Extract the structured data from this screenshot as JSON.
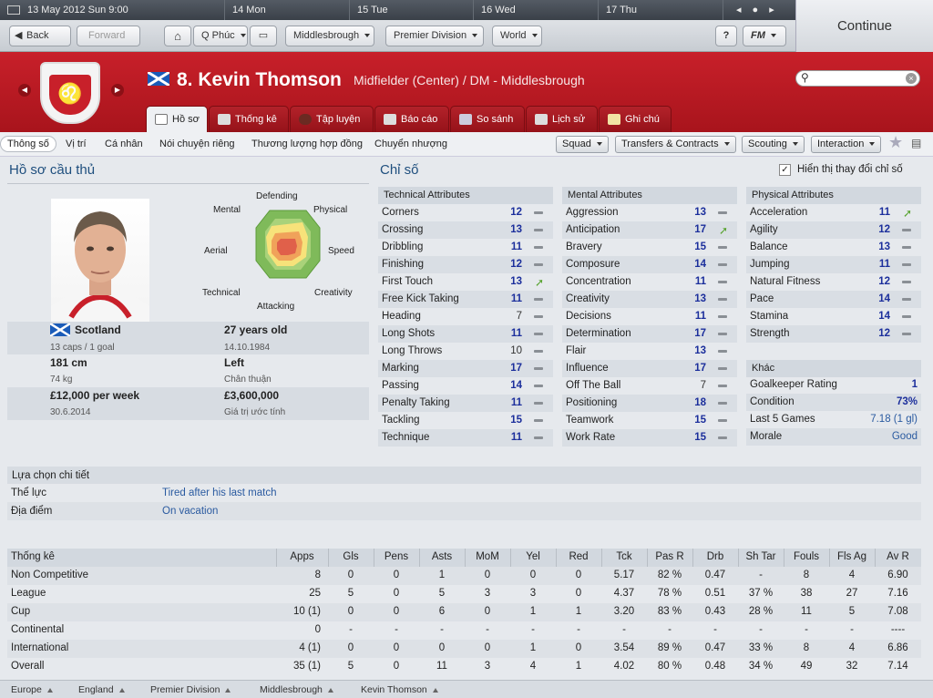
{
  "calendar": {
    "current": "13 May 2012 Sun 9:00",
    "days": [
      "14 Mon",
      "15 Tue",
      "16 Wed",
      "17 Thu"
    ]
  },
  "toolbar": {
    "back": "Back",
    "forward": "Forward",
    "manager": "Q Phúc",
    "club": "Middlesbrough",
    "league": "Premier Division",
    "world": "World",
    "help": "?",
    "fm": "FM",
    "continue": "Continue"
  },
  "player": {
    "number_name": "8. Kevin Thomson",
    "position": "Midfielder (Center) / DM - Middlesbrough"
  },
  "tabs": [
    "Hồ sơ",
    "Thống kê",
    "Tập luyện",
    "Báo cáo",
    "So sánh",
    "Lịch sử",
    "Ghi chú"
  ],
  "subnav": [
    "Thông số",
    "Vị trí",
    "Cá nhân",
    "Nói chuyện riêng",
    "Thương lượng hợp đồng",
    "Chuyển nhượng"
  ],
  "menus": [
    "Squad",
    "Transfers & Contracts",
    "Scouting",
    "Interaction"
  ],
  "profile": {
    "title": "Hồ sơ cầu thủ",
    "radar": [
      "Defending",
      "Physical",
      "Speed",
      "Creativity",
      "Attacking",
      "Technical",
      "Aerial",
      "Mental"
    ],
    "nation": "Scotland",
    "caps": "13 caps / 1 goal",
    "age": "27 years old",
    "dob": "14.10.1984",
    "height": "181 cm",
    "weight": "74 kg",
    "foot": "Left",
    "foot_label": "Chân thuận",
    "wage": "£12,000 per week",
    "contract": "30.6.2014",
    "value": "£3,600,000",
    "value_label": "Giá trị ước tính"
  },
  "attributes": {
    "title": "Chỉ số",
    "show_changes": "Hiển thị thay đổi chỉ số",
    "technical_title": "Technical Attributes",
    "technical": [
      {
        "n": "Corners",
        "v": "12",
        "t": "dash"
      },
      {
        "n": "Crossing",
        "v": "13",
        "t": "dash"
      },
      {
        "n": "Dribbling",
        "v": "11",
        "t": "dash"
      },
      {
        "n": "Finishing",
        "v": "12",
        "t": "dash"
      },
      {
        "n": "First Touch",
        "v": "13",
        "t": "up"
      },
      {
        "n": "Free Kick Taking",
        "v": "11",
        "t": "dash"
      },
      {
        "n": "Heading",
        "v": "7",
        "t": "dash"
      },
      {
        "n": "Long Shots",
        "v": "11",
        "t": "dash"
      },
      {
        "n": "Long Throws",
        "v": "10",
        "t": "dash"
      },
      {
        "n": "Marking",
        "v": "17",
        "t": "dash"
      },
      {
        "n": "Passing",
        "v": "14",
        "t": "dash"
      },
      {
        "n": "Penalty Taking",
        "v": "11",
        "t": "dash"
      },
      {
        "n": "Tackling",
        "v": "15",
        "t": "dash"
      },
      {
        "n": "Technique",
        "v": "11",
        "t": "dash"
      }
    ],
    "mental_title": "Mental Attributes",
    "mental": [
      {
        "n": "Aggression",
        "v": "13",
        "t": "dash"
      },
      {
        "n": "Anticipation",
        "v": "17",
        "t": "up"
      },
      {
        "n": "Bravery",
        "v": "15",
        "t": "dash"
      },
      {
        "n": "Composure",
        "v": "14",
        "t": "dash"
      },
      {
        "n": "Concentration",
        "v": "11",
        "t": "dash"
      },
      {
        "n": "Creativity",
        "v": "13",
        "t": "dash"
      },
      {
        "n": "Decisions",
        "v": "11",
        "t": "dash"
      },
      {
        "n": "Determination",
        "v": "17",
        "t": "dash"
      },
      {
        "n": "Flair",
        "v": "13",
        "t": "dash"
      },
      {
        "n": "Influence",
        "v": "17",
        "t": "dash"
      },
      {
        "n": "Off The Ball",
        "v": "7",
        "t": "dash"
      },
      {
        "n": "Positioning",
        "v": "18",
        "t": "dash"
      },
      {
        "n": "Teamwork",
        "v": "15",
        "t": "dash"
      },
      {
        "n": "Work Rate",
        "v": "15",
        "t": "dash"
      }
    ],
    "physical_title": "Physical Attributes",
    "physical": [
      {
        "n": "Acceleration",
        "v": "11",
        "t": "up"
      },
      {
        "n": "Agility",
        "v": "12",
        "t": "dash"
      },
      {
        "n": "Balance",
        "v": "13",
        "t": "dash"
      },
      {
        "n": "Jumping",
        "v": "11",
        "t": "dash"
      },
      {
        "n": "Natural Fitness",
        "v": "12",
        "t": "dash"
      },
      {
        "n": "Pace",
        "v": "14",
        "t": "dash"
      },
      {
        "n": "Stamina",
        "v": "14",
        "t": "dash"
      },
      {
        "n": "Strength",
        "v": "12",
        "t": "dash"
      }
    ],
    "other_title": "Khác",
    "other": [
      {
        "n": "Goalkeeper Rating",
        "v": "1"
      },
      {
        "n": "Condition",
        "v": "73%"
      },
      {
        "n": "Last 5 Games",
        "v": "7.18 (1 gl)"
      },
      {
        "n": "Morale",
        "v": "Good"
      }
    ]
  },
  "details": {
    "title": "Lựa chọn chi tiết",
    "rows": [
      {
        "l": "Thể lực",
        "v": "Tired after his last match"
      },
      {
        "l": "Địa điểm",
        "v": "On vacation"
      }
    ]
  },
  "stats": {
    "headers": [
      "Thống kê",
      "Apps",
      "Gls",
      "Pens",
      "Asts",
      "MoM",
      "Yel",
      "Red",
      "Tck",
      "Pas R",
      "Drb",
      "Sh Tar",
      "Fouls",
      "Fls Ag",
      "Av R"
    ],
    "rows": [
      [
        "Non Competitive",
        "8",
        "0",
        "0",
        "1",
        "0",
        "0",
        "0",
        "5.17",
        "82 %",
        "0.47",
        "-",
        "8",
        "4",
        "6.90"
      ],
      [
        "League",
        "25",
        "5",
        "0",
        "5",
        "3",
        "3",
        "0",
        "4.37",
        "78 %",
        "0.51",
        "37 %",
        "38",
        "27",
        "7.16"
      ],
      [
        "Cup",
        "10 (1)",
        "0",
        "0",
        "6",
        "0",
        "1",
        "1",
        "3.20",
        "83 %",
        "0.43",
        "28 %",
        "11",
        "5",
        "7.08"
      ],
      [
        "Continental",
        "0",
        "-",
        "-",
        "-",
        "-",
        "-",
        "-",
        "-",
        "-",
        "-",
        "-",
        "-",
        "-",
        "----"
      ],
      [
        "International",
        "4 (1)",
        "0",
        "0",
        "0",
        "0",
        "1",
        "0",
        "3.54",
        "89 %",
        "0.47",
        "33 %",
        "8",
        "4",
        "6.86"
      ],
      [
        "Overall",
        "35 (1)",
        "5",
        "0",
        "11",
        "3",
        "4",
        "1",
        "4.02",
        "80 %",
        "0.48",
        "34 %",
        "49",
        "32",
        "7.14"
      ]
    ]
  },
  "breadcrumbs": [
    "Europe",
    "England",
    "Premier Division",
    "Middlesbrough",
    "Kevin Thomson"
  ]
}
